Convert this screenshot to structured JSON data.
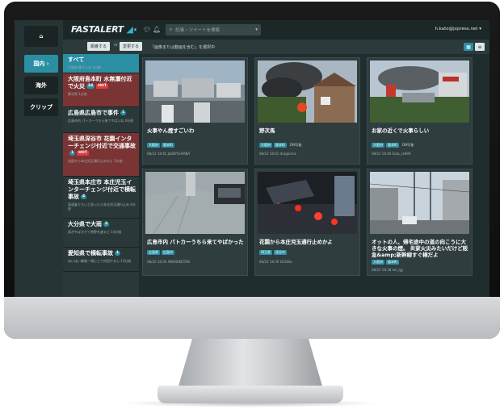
{
  "app": {
    "logo_main": "FASTALERT",
    "search_placeholder": "記事・ツイートを検索",
    "user": "h.kato@jxpress.net"
  },
  "nav": {
    "home_icon": "⌂",
    "japan": "国内",
    "overseas": "海外",
    "clip": "クリップ"
  },
  "filter": {
    "btn_register": "順番する",
    "btn_change": "変更する",
    "separator": "or",
    "note": "「画像または動画を含む」を選択中"
  },
  "topics": [
    {
      "title": "すべて",
      "meta": "大阪府 鹿子ヶ谷 1分前",
      "count": "",
      "hot": ""
    },
    {
      "title": "大阪府島本町 水無瀬付近で火災",
      "meta": "野次馬 1分前",
      "count": "24",
      "hot": "HOT"
    },
    {
      "title": "広島県広島市で事件",
      "meta": "広島市内 パトカーうちら来てやばいね 4分前",
      "count": "1",
      "hot": ""
    },
    {
      "title": "埼玉県深谷市 花園インターチェンジ付近で交通事故",
      "meta": "花園から本庄児玉通行止めかよ 3分前",
      "count": "1",
      "hot": "HOT"
    },
    {
      "title": "埼玉県本庄市 本庄児玉インターチェンジ付近で横転事故",
      "meta": "高速乗りたいと思ったら本庄児玉通行止め 4分前",
      "count": "4",
      "hot": ""
    },
    {
      "title": "大分県で大雨",
      "meta": "雨がやばすぎて視界を遮ると 14分前",
      "count": "3",
      "hot": ""
    },
    {
      "title": "愛知県で横転事故",
      "meta": "ほいほい事故一現にとて何回やるん 13分前",
      "count": "1",
      "hot": ""
    }
  ],
  "cards": [
    {
      "title": "火事やん煙すごいわ",
      "tags": [
        "大阪府",
        "島本町"
      ],
      "media": "",
      "meta": "08/22 18:42  JaiBOYGAMBA"
    },
    {
      "title": "野次馬",
      "tags": [
        "大阪府",
        "島本町"
      ],
      "media": "DM可能",
      "meta": "08/22 18:41  dragonmz"
    },
    {
      "title": "お家の近くで火事らしい",
      "tags": [
        "大阪府",
        "島本町"
      ],
      "media": "DM可能",
      "meta": "08/22 18:40  Sota_cs899"
    },
    {
      "title": "広島市内 パトカーうちら来てやばかった",
      "tags": [
        "広島県",
        "広島市"
      ],
      "media": "",
      "meta": "08/22 18:39  AWASEKETEN"
    },
    {
      "title": "花園から本庄児玉通行止めかよ",
      "tags": [
        "埼玉県",
        "深谷市"
      ],
      "media": "",
      "meta": "08/22 18:39  k03S6a"
    },
    {
      "title": "オットの人、帰宅途中の道の向こうに大きな火事の煙。 炎家火災みたいだけど阪急&amp;新幹線すぐ横だよ",
      "tags": [
        "大阪府",
        "島本町"
      ],
      "media": "",
      "meta": "08/22 18:38  kei_lgy"
    }
  ]
}
